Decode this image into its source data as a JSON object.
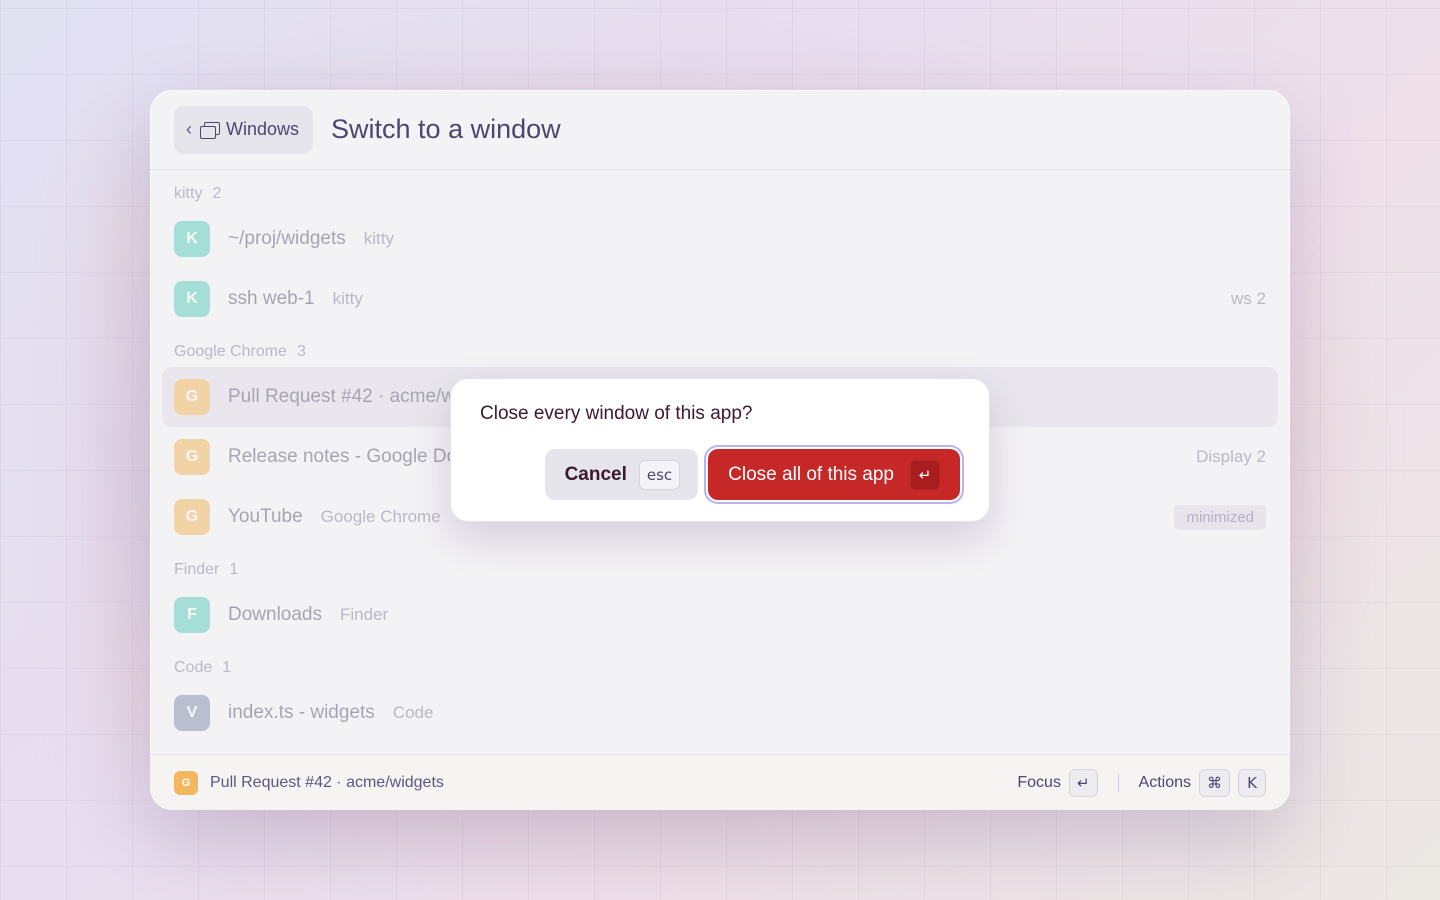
{
  "header": {
    "back_label": "Windows",
    "back_chevron": "‹",
    "title": "Switch to a window"
  },
  "groups": [
    {
      "name": "kitty",
      "count": "2",
      "rows": [
        {
          "avatar": "K",
          "color": "#3cc3b0",
          "title": "~/proj/widgets",
          "app": "kitty",
          "meta": ""
        },
        {
          "avatar": "K",
          "color": "#3cc3b0",
          "title": "ssh web-1",
          "app": "kitty",
          "meta": "ws 2"
        }
      ]
    },
    {
      "name": "Google Chrome",
      "count": "3",
      "rows": [
        {
          "avatar": "G",
          "color": "#f2a93b",
          "title": "Pull Request #42 · acme/widgets",
          "app": "",
          "meta": "",
          "selected": true
        },
        {
          "avatar": "G",
          "color": "#f2a93b",
          "title": "Release notes - Google Docs",
          "app": "",
          "meta": "Display 2"
        },
        {
          "avatar": "G",
          "color": "#f2a93b",
          "title": "YouTube",
          "app": "Google Chrome",
          "badge": "minimized"
        }
      ]
    },
    {
      "name": "Finder",
      "count": "1",
      "rows": [
        {
          "avatar": "F",
          "color": "#3cc3b0",
          "title": "Downloads",
          "app": "Finder",
          "meta": ""
        }
      ]
    },
    {
      "name": "Code",
      "count": "1",
      "rows": [
        {
          "avatar": "V",
          "color": "#6a7a9c",
          "title": "index.ts - widgets",
          "app": "Code",
          "meta": ""
        }
      ]
    }
  ],
  "footer": {
    "avatar": "G",
    "avatar_color": "#f2a93b",
    "selected_title": "Pull Request #42 · acme/widgets",
    "focus_label": "Focus",
    "focus_key": "↵",
    "actions_label": "Actions",
    "actions_keys": [
      "⌘",
      "K"
    ]
  },
  "dialog": {
    "title": "Close every window of this app?",
    "cancel_label": "Cancel",
    "cancel_key": "esc",
    "confirm_label": "Close all of this app",
    "confirm_key": "↵",
    "confirm_color": "#c62828"
  }
}
